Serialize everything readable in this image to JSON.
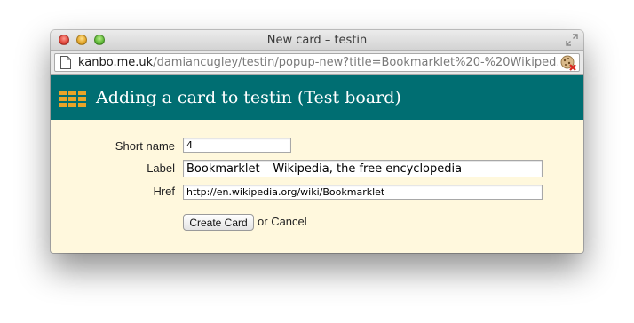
{
  "window": {
    "title": "New card – testin"
  },
  "address_bar": {
    "host": "kanbo.me.uk",
    "path": "/damiancugley/testin/popup-new?title=Bookmarklet%20-%20Wikiped…"
  },
  "header": {
    "title": "Adding a card to testin (Test board)"
  },
  "form": {
    "short_name": {
      "label": "Short name",
      "value": "4"
    },
    "label": {
      "label": "Label",
      "value": "Bookmarklet – Wikipedia, the free encyclopedia"
    },
    "href": {
      "label": "Href",
      "value": "http://en.wikipedia.org/wiki/Bookmarklet"
    },
    "submit_label": "Create Card",
    "or_text": "or",
    "cancel_label": "Cancel"
  },
  "colors": {
    "header_bg": "#006e72",
    "content_bg": "#fff8dd",
    "logo": "#e8a428"
  },
  "icons": [
    "close-icon",
    "minimize-icon",
    "zoom-icon",
    "resize-icon",
    "document-icon",
    "cookie-blocked-icon",
    "board-logo-icon"
  ]
}
